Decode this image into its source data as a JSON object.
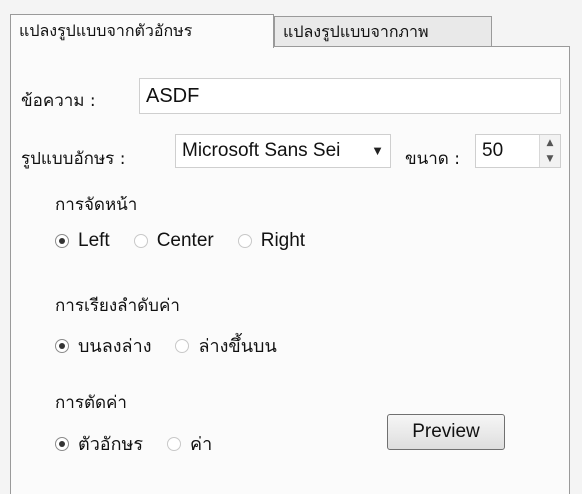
{
  "tabs": [
    {
      "label": "แปลงรูปแบบจากตัวอักษร",
      "active": true
    },
    {
      "label": "แปลงรูปแบบจากภาพ",
      "active": false
    }
  ],
  "message": {
    "label": "ข้อความ :",
    "value": "ASDF"
  },
  "font": {
    "label": "รูปแบบอักษร :",
    "value": "Microsoft Sans Sei"
  },
  "size": {
    "label": "ขนาด :",
    "value": "50"
  },
  "icons": {
    "dropdown": "chevron-down-icon",
    "spin_up": "arrow-up-icon",
    "spin_down": "arrow-down-icon"
  },
  "alignment": {
    "title": "การจัดหน้า",
    "options": [
      {
        "label": "Left",
        "checked": true
      },
      {
        "label": "Center",
        "checked": false
      },
      {
        "label": "Right",
        "checked": false
      }
    ]
  },
  "ordering": {
    "title": "การเรียงลำดับค่า",
    "options": [
      {
        "label": "บนลงล่าง",
        "checked": true
      },
      {
        "label": "ล่างขึ้นบน",
        "checked": false
      }
    ]
  },
  "cutting": {
    "title": "การตัดค่า",
    "options": [
      {
        "label": "ตัวอักษร",
        "checked": true
      },
      {
        "label": "ค่า",
        "checked": false
      }
    ]
  },
  "preview_button": "Preview"
}
